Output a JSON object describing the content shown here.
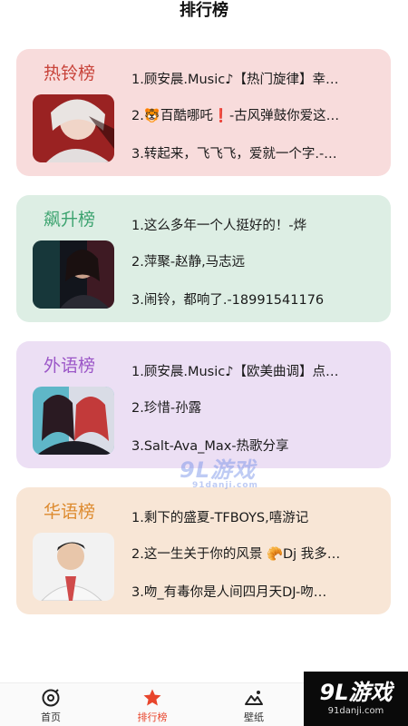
{
  "header": {
    "title": "排行榜"
  },
  "charts": [
    {
      "title": "热铃榜",
      "title_color": "#c8433a",
      "bg": "#f8dcdc",
      "songs": [
        "1.顾安晨.Music♪【热门旋律】幸…",
        "2.🐯百酷哪吒❗-古风弹鼓你爱这…",
        "3.转起来，飞飞飞，爱就一个字.-…"
      ]
    },
    {
      "title": "飙升榜",
      "title_color": "#3ca36f",
      "bg": "#ddeee4",
      "songs": [
        "1.这么多年一个人挺好的！-烨",
        "2.萍聚-赵静,马志远",
        "3.闹铃，都响了.-18991541176"
      ]
    },
    {
      "title": "外语榜",
      "title_color": "#9b56c7",
      "bg": "#ecdff4",
      "songs": [
        "1.顾安晨.Music♪【欧美曲调】点…",
        "2.珍惜-孙露",
        "3.Salt-Ava_Max-热歌分享"
      ]
    },
    {
      "title": "华语榜",
      "title_color": "#dd8a2e",
      "bg": "#f8e6d6",
      "songs": [
        "1.剩下的盛夏-TFBOYS,嘻游记",
        "2.这一生关于你的风景 🥐Dj 我多…",
        "3.吻_有毒你是人间四月天DJ-吻…"
      ]
    }
  ],
  "tabs": [
    {
      "label": "首页",
      "icon": "home-icon"
    },
    {
      "label": "排行榜",
      "icon": "star-icon",
      "active": true
    },
    {
      "label": "壁纸",
      "icon": "wallpaper-icon"
    }
  ],
  "watermark": {
    "text": "9L游戏",
    "sub": "91danji.com"
  },
  "badge": {
    "text": "9L游戏",
    "sub": "91danji.com"
  },
  "colors": {
    "active_tab": "#e8452c"
  }
}
